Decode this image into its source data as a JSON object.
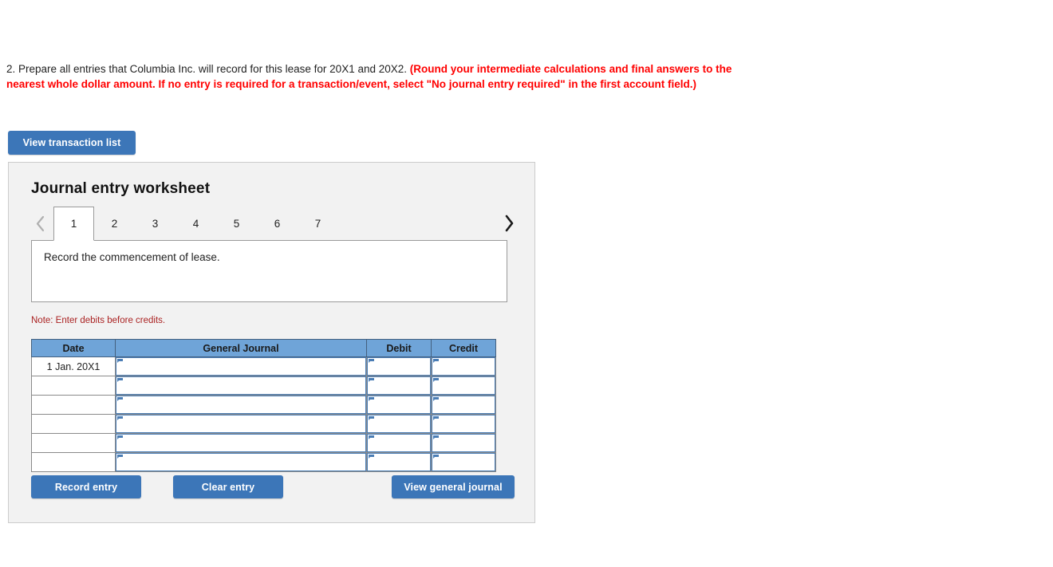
{
  "question": {
    "number": "2.",
    "main_text": "2. Prepare all entries that Columbia Inc. will record for this lease for 20X1 and 20X2.",
    "instruction_text": "(Round your intermediate calculations and final answers to the nearest whole dollar amount. If no entry is required for a transaction/event, select \"No journal entry required\" in the first account field.)"
  },
  "toolbar": {
    "view_transaction_list_label": "View transaction list"
  },
  "worksheet": {
    "title": "Journal entry worksheet",
    "tabs": [
      {
        "label": "1",
        "active": true
      },
      {
        "label": "2",
        "active": false
      },
      {
        "label": "3",
        "active": false
      },
      {
        "label": "4",
        "active": false
      },
      {
        "label": "5",
        "active": false
      },
      {
        "label": "6",
        "active": false
      },
      {
        "label": "7",
        "active": false
      }
    ],
    "nav": {
      "prev_icon": "chevron-left-icon",
      "next_icon": "chevron-right-icon"
    },
    "description": "Record the commencement of lease.",
    "note": "Note: Enter debits before credits.",
    "table": {
      "headers": [
        "Date",
        "General Journal",
        "Debit",
        "Credit"
      ],
      "rows": [
        {
          "date": "1 Jan. 20X1",
          "general_journal": "",
          "debit": "",
          "credit": ""
        },
        {
          "date": "",
          "general_journal": "",
          "debit": "",
          "credit": ""
        },
        {
          "date": "",
          "general_journal": "",
          "debit": "",
          "credit": ""
        },
        {
          "date": "",
          "general_journal": "",
          "debit": "",
          "credit": ""
        },
        {
          "date": "",
          "general_journal": "",
          "debit": "",
          "credit": ""
        },
        {
          "date": "",
          "general_journal": "",
          "debit": "",
          "credit": ""
        }
      ]
    },
    "buttons": {
      "record_entry_label": "Record entry",
      "clear_entry_label": "Clear entry",
      "view_general_journal_label": "View general journal"
    }
  },
  "colors": {
    "button_blue": "#3c76b8",
    "table_header_blue": "#6fa4d8",
    "panel_gray": "#f2f2f2",
    "alert_red": "#ff0000",
    "note_red": "#aa2222",
    "cell_border_blue": "#4a7db5"
  }
}
